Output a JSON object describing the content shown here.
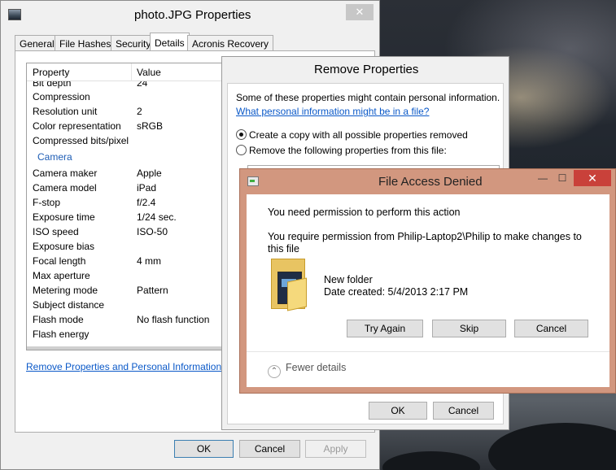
{
  "properties_window": {
    "title": "photo.JPG Properties",
    "close_label": "✕",
    "tabs": [
      {
        "label": "General"
      },
      {
        "label": "File Hashes"
      },
      {
        "label": "Security"
      },
      {
        "label": "Details"
      },
      {
        "label": "Acronis Recovery"
      }
    ],
    "active_tab": "Details",
    "columns": {
      "property": "Property",
      "value": "Value"
    },
    "rows_top": [
      {
        "property": "Bit depth",
        "value": "24"
      },
      {
        "property": "Compression",
        "value": ""
      },
      {
        "property": "Resolution unit",
        "value": "2"
      },
      {
        "property": "Color representation",
        "value": "sRGB"
      },
      {
        "property": "Compressed bits/pixel",
        "value": ""
      }
    ],
    "section_camera": "Camera",
    "rows_camera": [
      {
        "property": "Camera maker",
        "value": "Apple"
      },
      {
        "property": "Camera model",
        "value": "iPad"
      },
      {
        "property": "F-stop",
        "value": "f/2.4"
      },
      {
        "property": "Exposure time",
        "value": "1/24 sec."
      },
      {
        "property": "ISO speed",
        "value": "ISO-50"
      },
      {
        "property": "Exposure bias",
        "value": ""
      },
      {
        "property": "Focal length",
        "value": "4 mm"
      },
      {
        "property": "Max aperture",
        "value": ""
      },
      {
        "property": "Metering mode",
        "value": "Pattern"
      },
      {
        "property": "Subject distance",
        "value": ""
      },
      {
        "property": "Flash mode",
        "value": "No flash function"
      },
      {
        "property": "Flash energy",
        "value": ""
      }
    ],
    "remove_link": "Remove Properties and Personal Information",
    "buttons": {
      "ok": "OK",
      "cancel": "Cancel",
      "apply": "Apply"
    }
  },
  "remove_properties": {
    "title": "Remove Properties",
    "info": "Some of these properties might contain personal information.",
    "link": "What personal information might be in a file?",
    "option_copy": "Create a copy with all possible properties removed",
    "option_remove": "Remove the following properties from this file:",
    "selected_option": "copy",
    "buttons": {
      "ok": "OK",
      "cancel": "Cancel"
    }
  },
  "access_denied": {
    "title": "File Access Denied",
    "controls": {
      "minimize": "—",
      "maximize": "☐",
      "close": "✕"
    },
    "message1": "You need permission to perform this action",
    "message2": "You require permission from Philip-Laptop2\\Philip to make changes to this file",
    "item_name": "New folder",
    "item_date": "Date created: 5/4/2013 2:17 PM",
    "buttons": {
      "try_again": "Try Again",
      "skip": "Skip",
      "cancel": "Cancel"
    },
    "fewer_details": "Fewer details",
    "fewer_details_chevron": "⌃",
    "accent_color": "#d2977f"
  }
}
